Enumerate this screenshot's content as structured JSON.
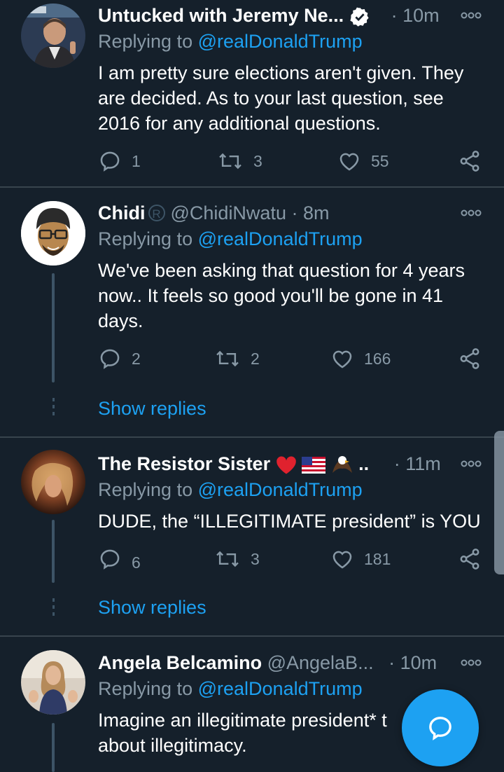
{
  "tweets": [
    {
      "name": "Untucked with Jeremy Ne...",
      "handle": "",
      "time": "10m",
      "replying_label": "Replying to",
      "mention": "@realDonaldTrump",
      "text": "I am pretty sure elections aren't given. They are decided. As to your last question, see 2016 for any additional questions.",
      "reply_count": "1",
      "retweet_count": "3",
      "like_count": "55",
      "verified": true
    },
    {
      "name": "Chidi",
      "handle": "@ChidiNwatu",
      "time": "8m",
      "replying_label": "Replying to",
      "mention": "@realDonaldTrump",
      "text": "We've been asking that question for 4 years now.. It feels so good you'll be gone in 41 days.",
      "reply_count": "2",
      "retweet_count": "2",
      "like_count": "166",
      "show_replies": "Show replies"
    },
    {
      "name": "The Resistor Sister",
      "name_suffix": "..",
      "handle": "",
      "time": "11m",
      "replying_label": "Replying to",
      "mention": "@realDonaldTrump",
      "text": "DUDE, the “ILLEGITIMATE president” is YOU",
      "reply_count": "6",
      "retweet_count": "3",
      "like_count": "181",
      "show_replies": "Show replies"
    },
    {
      "name": "Angela Belcamino",
      "handle": "@AngelaB...",
      "time": "10m",
      "replying_label": "Replying to",
      "mention": "@realDonaldTrump",
      "text_line1": "Imagine an illegitimate president* t",
      "text_line2": "about illegitimacy."
    }
  ],
  "separator": "·",
  "icons": [
    "verified-badge-icon",
    "more-icon",
    "reply-icon",
    "retweet-icon",
    "like-icon",
    "share-icon",
    "compose-reply-icon",
    "registered-mark-icon",
    "heart-emoji-icon",
    "us-flag-emoji-icon",
    "eagle-emoji-icon"
  ],
  "colors": {
    "background": "#15202b",
    "accent": "#1da1f2",
    "secondary_text": "#8899a6",
    "divider": "#38444d"
  }
}
